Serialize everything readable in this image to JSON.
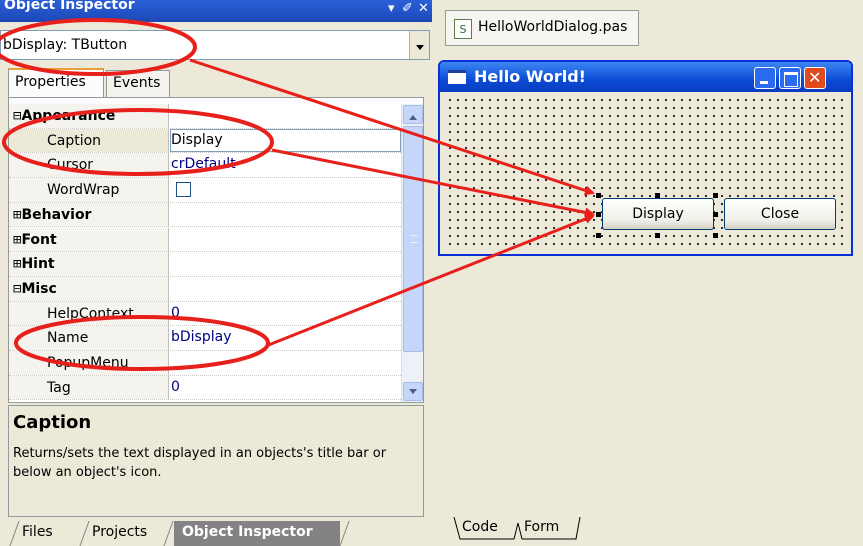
{
  "inspector": {
    "title": "Object Inspector",
    "title_icons": [
      "▾",
      "✐",
      "✕"
    ],
    "selected_object": "bDisplay: TButton",
    "tabs": {
      "properties": "Properties",
      "events": "Events"
    },
    "rows": [
      {
        "kind": "cat",
        "sign": "⊟",
        "name": "Appearance",
        "value": ""
      },
      {
        "kind": "prop",
        "name": "Caption",
        "value": "Display",
        "selected": true
      },
      {
        "kind": "prop",
        "name": "Cursor",
        "value": "crDefault"
      },
      {
        "kind": "prop",
        "name": "WordWrap",
        "value": "",
        "checkbox": true
      },
      {
        "kind": "cat",
        "sign": "⊞",
        "name": "Behavior",
        "value": ""
      },
      {
        "kind": "cat",
        "sign": "⊞",
        "name": "Font",
        "value": ""
      },
      {
        "kind": "cat",
        "sign": "⊞",
        "name": "Hint",
        "value": ""
      },
      {
        "kind": "cat",
        "sign": "⊟",
        "name": "Misc",
        "value": ""
      },
      {
        "kind": "prop",
        "name": "HelpContext",
        "value": "0"
      },
      {
        "kind": "prop",
        "name": "Name",
        "value": "bDisplay"
      },
      {
        "kind": "prop",
        "name": "PopupMenu",
        "value": ""
      },
      {
        "kind": "prop",
        "name": "Tag",
        "value": "0"
      }
    ],
    "description": {
      "heading": "Caption",
      "body": "Returns/sets the text displayed in an objects's title bar or below an object's icon."
    },
    "bottom_tabs": [
      "Files",
      "Projects",
      "Object Inspector"
    ]
  },
  "designer": {
    "file_tab": "HelloWorldDialog.pas",
    "file_icon_glyph": "S",
    "form_title": "Hello World!",
    "buttons": {
      "display": "Display",
      "close": "Close"
    },
    "view_tabs": {
      "code": "Code",
      "form": "Form"
    }
  },
  "colors": {
    "annotation_red": "#e8201c",
    "titlebar_blue": "#0b4bd4",
    "selection_orange": "#e8a03a"
  }
}
